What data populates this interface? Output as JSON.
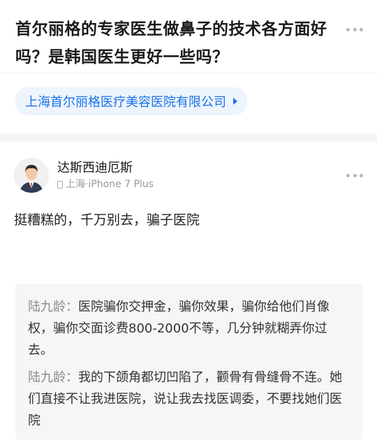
{
  "question": {
    "title": "首尔丽格的专家医生做鼻子的技术各方面好吗？是韩国医生更好一些吗？"
  },
  "company": {
    "label": "上海首尔丽格医疗美容医院有限公司"
  },
  "answer": {
    "author_name": "达斯西迪厄斯",
    "author_location_device": "上海·iPhone 7 Plus",
    "text": "挺糟糕的，千万别去，骗子医院"
  },
  "comments": [
    {
      "name": "陆九龄：",
      "text": "医院骗你交押金，骗你效果，骗你给他们肖像权，骗你交面诊费800-2000不等，几分钟就糊弄你过去。"
    },
    {
      "name": "陆九龄：",
      "text": "我的下颌角都切凹陷了，颧骨有骨缝骨不连。她们直接不让我进医院，说让我去找医调委，不要找她们医院"
    }
  ],
  "icons": {
    "more": "more-dots-icon",
    "device": "phone-icon",
    "arrow": "chevron-right-icon",
    "avatar": "avatar-person-icon"
  },
  "colors": {
    "accent": "#1a73e8",
    "tag_bg": "#eef4fc",
    "quote_bg": "#f6f6f6",
    "muted": "#999999"
  }
}
